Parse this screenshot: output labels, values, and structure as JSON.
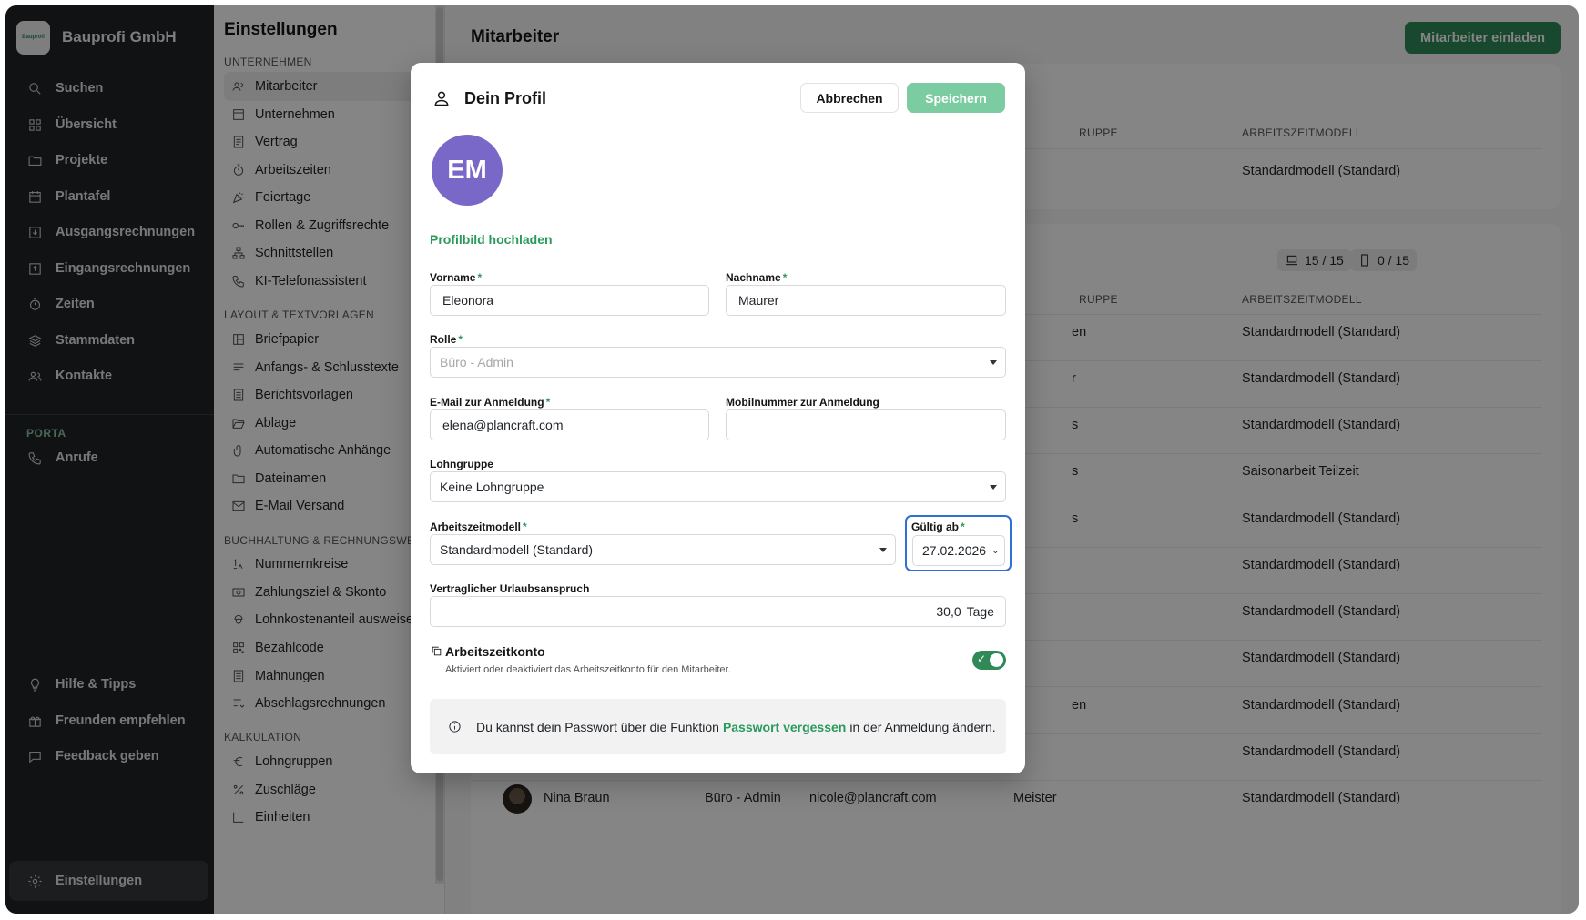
{
  "company": {
    "name": "Bauprofi GmbH",
    "logo_text": "Bauprofi"
  },
  "nav": {
    "items": [
      "Suchen",
      "Übersicht",
      "Projekte",
      "Plantafel",
      "Ausgangsrechnungen",
      "Eingangsrechnungen",
      "Zeiten",
      "Stammdaten",
      "Kontakte"
    ],
    "section": "PORTA",
    "porta_items": [
      "Anrufe"
    ],
    "bottom_items": [
      "Hilfe & Tipps",
      "Freunden empfehlen",
      "Feedback geben",
      "Einstellungen"
    ]
  },
  "settings": {
    "title": "Einstellungen",
    "sections": [
      {
        "label": "UNTERNEHMEN",
        "items": [
          "Mitarbeiter",
          "Unternehmen",
          "Vertrag",
          "Arbeitszeiten",
          "Feiertage",
          "Rollen & Zugriffsrechte",
          "Schnittstellen",
          "KI-Telefonassistent"
        ]
      },
      {
        "label": "LAYOUT & TEXTVORLAGEN",
        "items": [
          "Briefpapier",
          "Anfangs- & Schlusstexte",
          "Berichtsvorlagen",
          "Ablage",
          "Automatische Anhänge",
          "Dateinamen",
          "E-Mail Versand"
        ]
      },
      {
        "label": "BUCHHALTUNG & RECHNUNGSWESEN",
        "items": [
          "Nummernkreise",
          "Zahlungsziel & Skonto",
          "Lohnkostenanteil ausweisen",
          "Bezahlcode",
          "Mahnungen",
          "Abschlagsrechnungen"
        ]
      },
      {
        "label": "KALKULATION",
        "items": [
          "Lohngruppen",
          "Zuschläge",
          "Einheiten"
        ]
      }
    ]
  },
  "main": {
    "title": "Mitarbeiter",
    "invite_button": "Mitarbeiter einladen",
    "col_group_partial": "RUPPE",
    "col_model": "ARBEITSZEITMODELL",
    "card1_model": "Standardmodell (Standard)",
    "badge_desktop": "15 / 15",
    "badge_mobile": "0 / 15",
    "rows": [
      {
        "partial": "en",
        "model": "Standardmodell (Standard)"
      },
      {
        "partial": "r",
        "model": "Standardmodell (Standard)"
      },
      {
        "partial": "s",
        "model": "Standardmodell (Standard)"
      },
      {
        "partial": "s",
        "model": "Saisonarbeit Teilzeit"
      },
      {
        "partial": "s",
        "model": "Standardmodell (Standard)"
      },
      {
        "partial": "",
        "model": "Standardmodell (Standard)"
      },
      {
        "partial": "",
        "model": "Standardmodell (Standard)"
      },
      {
        "partial": "",
        "model": "Standardmodell (Standard)"
      },
      {
        "partial": "en",
        "model": "Standardmodell (Standard)"
      },
      {
        "partial": "",
        "model": "Standardmodell (Standard)"
      }
    ],
    "last_row": {
      "name": "Nina Braun",
      "role": "Büro - Admin",
      "email": "nicole@plancraft.com",
      "group": "Meister",
      "model": "Standardmodell (Standard)"
    }
  },
  "modal": {
    "title": "Dein Profil",
    "cancel": "Abbrechen",
    "save": "Speichern",
    "avatar_initials": "EM",
    "upload": "Profilbild hochladen",
    "vorname_label": "Vorname",
    "vorname": "Eleonora",
    "nachname_label": "Nachname",
    "nachname": "Maurer",
    "rolle_label": "Rolle",
    "rolle_placeholder": "Büro - Admin",
    "email_label": "E-Mail zur Anmeldung",
    "email": "elena@plancraft.com",
    "mobil_label": "Mobilnummer zur Anmeldung",
    "mobil": "",
    "lohngruppe_label": "Lohngruppe",
    "lohngruppe": "Keine Lohngruppe",
    "azm_label": "Arbeitszeitmodell",
    "azm": "Standardmodell (Standard)",
    "gueltig_label": "Gültig ab",
    "gueltig": "27.02.2026",
    "urlaub_label": "Vertraglicher Urlaubsanspruch",
    "urlaub_value": "30,0",
    "urlaub_unit": "Tage",
    "azk_title": "Arbeitszeitkonto",
    "azk_desc": "Aktiviert oder deaktiviert das Arbeitszeitkonto für den Mitarbeiter.",
    "azk_enabled": true,
    "info_pre": "Du kannst dein Passwort über die Funktion",
    "info_link": "Passwort vergessen",
    "info_post": "in der Anmeldung ändern."
  },
  "colors": {
    "accent": "#2f8a57",
    "save_disabled": "#7ccca2",
    "avatar": "#7a68c9",
    "focus": "#2f6fd6"
  }
}
